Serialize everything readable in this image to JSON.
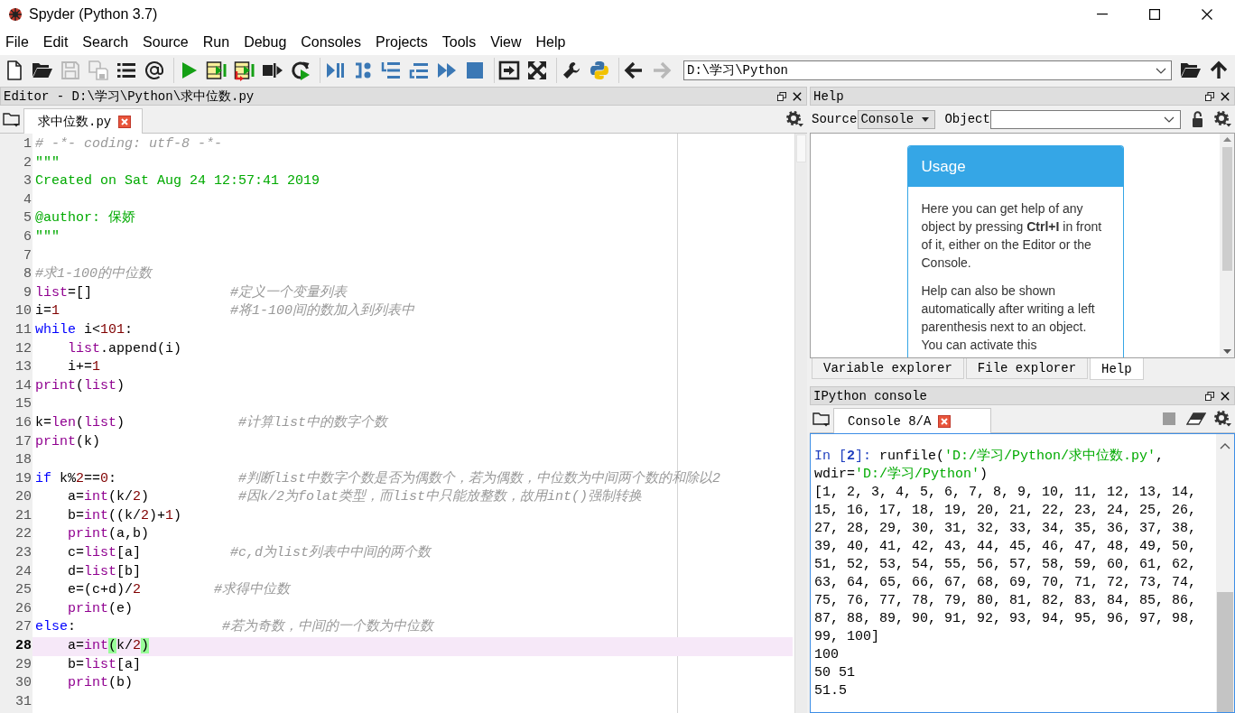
{
  "window": {
    "title": "Spyder (Python 3.7)"
  },
  "menu": [
    "File",
    "Edit",
    "Search",
    "Source",
    "Run",
    "Debug",
    "Consoles",
    "Projects",
    "Tools",
    "View",
    "Help"
  ],
  "toolbar": {
    "groups": [
      {
        "buttons": [
          {
            "kind": "new-file",
            "disabled": false
          },
          {
            "kind": "open-folder",
            "disabled": false
          },
          {
            "kind": "save",
            "disabled": true
          },
          {
            "kind": "save-all",
            "disabled": true
          },
          {
            "kind": "list",
            "disabled": false
          },
          {
            "kind": "at",
            "disabled": false
          }
        ]
      },
      {
        "buttons": [
          {
            "kind": "run",
            "disabled": false
          },
          {
            "kind": "run-cell",
            "disabled": false
          },
          {
            "kind": "run-cell-advance",
            "disabled": false
          },
          {
            "kind": "run-selection",
            "disabled": false
          },
          {
            "kind": "rerun",
            "disabled": false
          }
        ]
      },
      {
        "buttons": [
          {
            "kind": "debug",
            "disabled": false
          },
          {
            "kind": "step",
            "disabled": false
          },
          {
            "kind": "step-into",
            "disabled": false
          },
          {
            "kind": "step-return",
            "disabled": false
          },
          {
            "kind": "continue",
            "disabled": false
          },
          {
            "kind": "stop",
            "disabled": false
          }
        ]
      },
      {
        "buttons": [
          {
            "kind": "maximize",
            "disabled": false
          },
          {
            "kind": "fullscreen",
            "disabled": false
          }
        ]
      },
      {
        "buttons": [
          {
            "kind": "wrench",
            "disabled": false
          },
          {
            "kind": "python",
            "disabled": false
          }
        ]
      },
      {
        "buttons": [
          {
            "kind": "back",
            "disabled": false
          },
          {
            "kind": "forward",
            "disabled": true
          }
        ]
      }
    ],
    "path": "D:\\学习\\Python",
    "path_buttons": [
      {
        "kind": "open-folder",
        "disabled": false
      },
      {
        "kind": "up",
        "disabled": false
      }
    ]
  },
  "editor": {
    "title": "Editor - D:\\学习\\Python\\求中位数.py",
    "tabs": [
      {
        "label": "求中位数.py",
        "selected": true
      }
    ],
    "lines": [
      {
        "number": "1",
        "current": false,
        "tokens": [
          {
            "text": "# -*- coding: utf-8 -*-",
            "kind": "comment"
          }
        ]
      },
      {
        "number": "2",
        "current": false,
        "tokens": [
          {
            "text": "\"\"\"",
            "kind": "string"
          }
        ]
      },
      {
        "number": "3",
        "current": false,
        "tokens": [
          {
            "text": "Created on Sat Aug 24 12:57:41 2019",
            "kind": "string"
          }
        ]
      },
      {
        "number": "4",
        "current": false
      },
      {
        "number": "5",
        "current": false,
        "tokens": [
          {
            "text": "@author: 保娇",
            "kind": "string"
          }
        ]
      },
      {
        "number": "6",
        "current": false,
        "tokens": [
          {
            "text": "\"\"\"",
            "kind": "string"
          }
        ]
      },
      {
        "number": "7",
        "current": false
      },
      {
        "number": "8",
        "current": false,
        "tokens": [
          {
            "text": "#求1-100的中位数",
            "kind": "comment"
          }
        ]
      },
      {
        "number": "9",
        "current": false,
        "tokens": [
          {
            "text": "list",
            "kind": "builtin"
          },
          {
            "text": "=[]",
            "kind": "plain"
          },
          {
            "text": "                 #定义一个变量列表",
            "kind": "comment"
          }
        ]
      },
      {
        "number": "10",
        "current": false,
        "tokens": [
          {
            "text": "i=",
            "kind": "plain"
          },
          {
            "text": "1",
            "kind": "number"
          },
          {
            "text": "                     #将1-100间的数加入到列表中",
            "kind": "comment"
          }
        ]
      },
      {
        "number": "11",
        "current": false,
        "tokens": [
          {
            "text": "while",
            "kind": "keyword"
          },
          {
            "text": " i<",
            "kind": "plain"
          },
          {
            "text": "101",
            "kind": "number"
          },
          {
            "text": ":",
            "kind": "plain"
          }
        ]
      },
      {
        "number": "12",
        "current": false,
        "tokens": [
          {
            "text": "    list",
            "kind": "builtin"
          },
          {
            "text": ".append(i)",
            "kind": "plain"
          }
        ]
      },
      {
        "number": "13",
        "current": false,
        "tokens": [
          {
            "text": "    i+=",
            "kind": "plain"
          },
          {
            "text": "1",
            "kind": "number"
          }
        ]
      },
      {
        "number": "14",
        "current": false,
        "tokens": [
          {
            "text": "print",
            "kind": "builtin"
          },
          {
            "text": "(",
            "kind": "plain"
          },
          {
            "text": "list",
            "kind": "builtin"
          },
          {
            "text": ")",
            "kind": "plain"
          }
        ]
      },
      {
        "number": "15",
        "current": false
      },
      {
        "number": "16",
        "current": false,
        "tokens": [
          {
            "text": "k=",
            "kind": "plain"
          },
          {
            "text": "len",
            "kind": "builtin"
          },
          {
            "text": "(",
            "kind": "plain"
          },
          {
            "text": "list",
            "kind": "builtin"
          },
          {
            "text": ")",
            "kind": "plain"
          },
          {
            "text": "              #计算list中的数字个数",
            "kind": "comment"
          }
        ]
      },
      {
        "number": "17",
        "current": false,
        "tokens": [
          {
            "text": "print",
            "kind": "builtin"
          },
          {
            "text": "(k)",
            "kind": "plain"
          }
        ]
      },
      {
        "number": "18",
        "current": false
      },
      {
        "number": "19",
        "current": false,
        "tokens": [
          {
            "text": "if",
            "kind": "keyword"
          },
          {
            "text": " k%",
            "kind": "plain"
          },
          {
            "text": "2",
            "kind": "number"
          },
          {
            "text": "==",
            "kind": "plain"
          },
          {
            "text": "0",
            "kind": "number"
          },
          {
            "text": ":",
            "kind": "plain"
          },
          {
            "text": "               #判断list中数字个数是否为偶数个，若为偶数，中位数为中间两个数的和除以2",
            "kind": "comment"
          }
        ]
      },
      {
        "number": "20",
        "current": false,
        "tokens": [
          {
            "text": "    a=",
            "kind": "plain"
          },
          {
            "text": "int",
            "kind": "builtin"
          },
          {
            "text": "(k/",
            "kind": "plain"
          },
          {
            "text": "2",
            "kind": "number"
          },
          {
            "text": ")",
            "kind": "plain"
          },
          {
            "text": "           #因k/2为folat类型，而list中只能放整数，故用int()强制转换",
            "kind": "comment"
          }
        ]
      },
      {
        "number": "21",
        "current": false,
        "tokens": [
          {
            "text": "    b=",
            "kind": "plain"
          },
          {
            "text": "int",
            "kind": "builtin"
          },
          {
            "text": "((k/",
            "kind": "plain"
          },
          {
            "text": "2",
            "kind": "number"
          },
          {
            "text": ")+",
            "kind": "plain"
          },
          {
            "text": "1",
            "kind": "number"
          },
          {
            "text": ")",
            "kind": "plain"
          }
        ]
      },
      {
        "number": "22",
        "current": false,
        "tokens": [
          {
            "text": "    print",
            "kind": "builtin"
          },
          {
            "text": "(a,b)",
            "kind": "plain"
          }
        ]
      },
      {
        "number": "23",
        "current": false,
        "tokens": [
          {
            "text": "    c=",
            "kind": "plain"
          },
          {
            "text": "list",
            "kind": "builtin"
          },
          {
            "text": "[a]",
            "kind": "plain"
          },
          {
            "text": "           #c,d为list列表中中间的两个数",
            "kind": "comment"
          }
        ]
      },
      {
        "number": "24",
        "current": false,
        "tokens": [
          {
            "text": "    d=",
            "kind": "plain"
          },
          {
            "text": "list",
            "kind": "builtin"
          },
          {
            "text": "[b]",
            "kind": "plain"
          }
        ]
      },
      {
        "number": "25",
        "current": false,
        "tokens": [
          {
            "text": "    e=(c+d)/",
            "kind": "plain"
          },
          {
            "text": "2",
            "kind": "number"
          },
          {
            "text": "         #求得中位数",
            "kind": "comment"
          }
        ]
      },
      {
        "number": "26",
        "current": false,
        "tokens": [
          {
            "text": "    print",
            "kind": "builtin"
          },
          {
            "text": "(e)",
            "kind": "plain"
          }
        ]
      },
      {
        "number": "27",
        "current": false,
        "tokens": [
          {
            "text": "else",
            "kind": "keyword"
          },
          {
            "text": ":",
            "kind": "plain"
          },
          {
            "text": "                  #若为奇数，中间的一个数为中位数",
            "kind": "comment"
          }
        ]
      },
      {
        "number": "28",
        "current": true,
        "tokens": [
          {
            "text": "    a=",
            "kind": "plain"
          },
          {
            "text": "int",
            "kind": "builtin"
          },
          {
            "text": "(",
            "kind": "bracket-match"
          },
          {
            "text": "k/",
            "kind": "plain"
          },
          {
            "text": "2",
            "kind": "number"
          },
          {
            "text": ")",
            "kind": "bracket-match"
          }
        ]
      },
      {
        "number": "29",
        "current": false,
        "tokens": [
          {
            "text": "    b=",
            "kind": "plain"
          },
          {
            "text": "list",
            "kind": "builtin"
          },
          {
            "text": "[a]",
            "kind": "plain"
          }
        ]
      },
      {
        "number": "30",
        "current": false,
        "tokens": [
          {
            "text": "    print",
            "kind": "builtin"
          },
          {
            "text": "(b)",
            "kind": "plain"
          }
        ]
      },
      {
        "number": "31",
        "current": false
      }
    ]
  },
  "help": {
    "title": "Help",
    "source_label": "Source",
    "source_value": "Console",
    "object_label": "Object",
    "card": {
      "title": "Usage",
      "paragraphs": [
        "Here you can get help of any object by pressing **Ctrl+I** in front of it, either on the Editor or the Console.",
        "Help can also be shown automatically after writing a left parenthesis next to an object. You can activate this"
      ]
    },
    "dock_tabs": [
      {
        "label": "Variable explorer",
        "selected": false
      },
      {
        "label": "File explorer",
        "selected": false
      },
      {
        "label": "Help",
        "selected": true
      }
    ]
  },
  "console": {
    "title": "IPython console",
    "tabs": [
      {
        "label": "Console 8/A",
        "selected": true
      }
    ],
    "lines": [
      {
        "tokens": [
          {
            "text": "In [",
            "kind": "prompt"
          },
          {
            "text": "2",
            "kind": "prompt-number"
          },
          {
            "text": "]: ",
            "kind": "prompt"
          },
          {
            "text": "runfile(",
            "kind": "plain"
          },
          {
            "text": "'D:/学习/Python/求中位数.py'",
            "kind": "string"
          },
          {
            "text": ",",
            "kind": "plain"
          }
        ]
      },
      {
        "tokens": [
          {
            "text": "wdir=",
            "kind": "plain"
          },
          {
            "text": "'D:/学习/Python'",
            "kind": "string"
          },
          {
            "text": ")",
            "kind": "plain"
          }
        ]
      },
      {
        "tokens": [
          {
            "text": "[1, 2, 3, 4, 5, 6, 7, 8, 9, 10, 11, 12, 13, 14,",
            "kind": "plain"
          }
        ]
      },
      {
        "tokens": [
          {
            "text": "15, 16, 17, 18, 19, 20, 21, 22, 23, 24, 25, 26,",
            "kind": "plain"
          }
        ]
      },
      {
        "tokens": [
          {
            "text": "27, 28, 29, 30, 31, 32, 33, 34, 35, 36, 37, 38,",
            "kind": "plain"
          }
        ]
      },
      {
        "tokens": [
          {
            "text": "39, 40, 41, 42, 43, 44, 45, 46, 47, 48, 49, 50,",
            "kind": "plain"
          }
        ]
      },
      {
        "tokens": [
          {
            "text": "51, 52, 53, 54, 55, 56, 57, 58, 59, 60, 61, 62,",
            "kind": "plain"
          }
        ]
      },
      {
        "tokens": [
          {
            "text": "63, 64, 65, 66, 67, 68, 69, 70, 71, 72, 73, 74,",
            "kind": "plain"
          }
        ]
      },
      {
        "tokens": [
          {
            "text": "75, 76, 77, 78, 79, 80, 81, 82, 83, 84, 85, 86,",
            "kind": "plain"
          }
        ]
      },
      {
        "tokens": [
          {
            "text": "87, 88, 89, 90, 91, 92, 93, 94, 95, 96, 97, 98,",
            "kind": "plain"
          }
        ]
      },
      {
        "tokens": [
          {
            "text": "99, 100]",
            "kind": "plain"
          }
        ]
      },
      {
        "tokens": [
          {
            "text": "100",
            "kind": "plain"
          }
        ]
      },
      {
        "tokens": [
          {
            "text": "50 51",
            "kind": "plain"
          }
        ]
      },
      {
        "tokens": [
          {
            "text": "51.5",
            "kind": "plain"
          }
        ]
      }
    ]
  }
}
